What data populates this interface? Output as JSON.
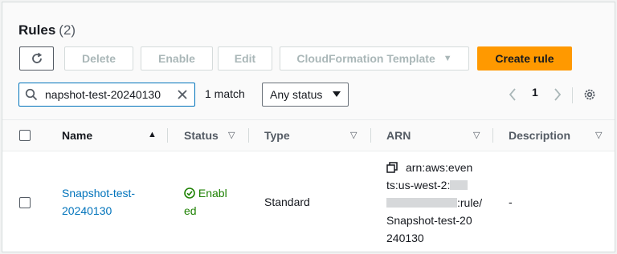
{
  "header": {
    "title": "Rules",
    "count": "(2)"
  },
  "toolbar": {
    "delete_label": "Delete",
    "enable_label": "Enable",
    "edit_label": "Edit",
    "cloudformation_label": "CloudFormation Template",
    "create_label": "Create rule"
  },
  "filter": {
    "search_value": "napshot-test-20240130",
    "match_text": "1 match",
    "status_select": "Any status"
  },
  "pagination": {
    "current_page": "1"
  },
  "table": {
    "columns": [
      "Name",
      "Status",
      "Type",
      "ARN",
      "Description"
    ],
    "rows": [
      {
        "name_line1": "Snapshot-test-",
        "name_line2": "20240130",
        "status_line1": "Enabl",
        "status_line2": "ed",
        "type": "Standard",
        "arn_line1": "arn:aws:even",
        "arn_line2": "ts:us-west-2:",
        "arn_line3": ":rule/",
        "arn_line4": "Snapshot-test-20",
        "arn_line5": "240130",
        "description": "-"
      }
    ]
  },
  "colors": {
    "primary": "#ff9900",
    "link": "#0073bb",
    "enabled": "#1d8102"
  }
}
